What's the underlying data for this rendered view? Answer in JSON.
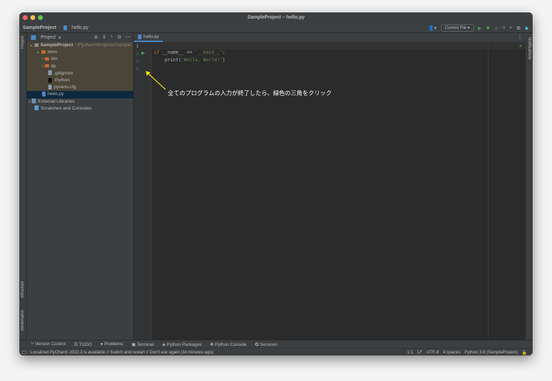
{
  "window": {
    "title": "SampleProject – hello.py"
  },
  "breadcrumb": {
    "project": "SampleProject",
    "file": "hello.py"
  },
  "toolbar": {
    "run_config": "Current File"
  },
  "left_stripe": {
    "project": "Project",
    "structure": "Structure",
    "bookmarks": "Bookmarks"
  },
  "right_stripe": {
    "notifications": "Notifications"
  },
  "project_panel": {
    "title": "Project",
    "root": {
      "name": "SampleProject",
      "path": "~/PycharmProjects/Sample"
    },
    "items": [
      {
        "label": "venv"
      },
      {
        "label": "bin"
      },
      {
        "label": "lib"
      },
      {
        "label": ".gitignore"
      },
      {
        "label": ".Python"
      },
      {
        "label": "pyvenv.cfg"
      },
      {
        "label": "hello.py"
      },
      {
        "label": "External Libraries"
      },
      {
        "label": "Scratches and Consoles"
      }
    ]
  },
  "editor": {
    "tab": "hello.py",
    "line_numbers": [
      "1",
      "2",
      "3",
      "4"
    ],
    "code": {
      "kw_if": "if",
      "cond": " __name__ == ",
      "main_str": "'__main__'",
      "colon": ":",
      "print_pre": "    print(",
      "hello_str": "'Hello, World!'",
      "print_post": ")"
    },
    "annotation": "全てのプログラムの入力が終了したら、緑色の三角をクリック"
  },
  "bottom_tools": [
    "Version Control",
    "TODO",
    "Problems",
    "Terminal",
    "Python Packages",
    "Python Console",
    "Services"
  ],
  "status": {
    "message": "Localized PyCharm 2022.3 is available // Switch and restart // Don't ask again (34 minutes ago)",
    "position": "1:1",
    "line_sep": "LF",
    "encoding": "UTF-8",
    "indent": "4 spaces",
    "interpreter": "Python 3.8 (SampleProject)"
  },
  "colors": {
    "accent": "#4a88c7",
    "run_green": "#499c54",
    "arrow": "#f2e600"
  }
}
